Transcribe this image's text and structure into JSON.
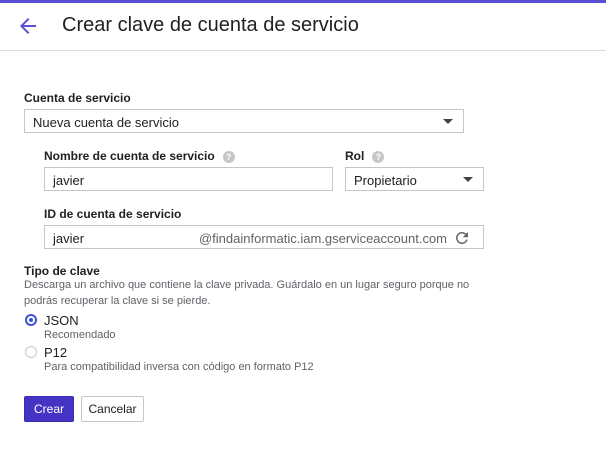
{
  "header": {
    "title": "Crear clave de cuenta de servicio"
  },
  "service_account": {
    "label": "Cuenta de servicio",
    "selected": "Nueva cuenta de servicio"
  },
  "account_name": {
    "label": "Nombre de cuenta de servicio",
    "value": "javier"
  },
  "role": {
    "label": "Rol",
    "selected": "Propietario"
  },
  "account_id": {
    "label": "ID de cuenta de servicio",
    "value": "javier",
    "suffix": "@findainformatic.iam.gserviceaccount.com"
  },
  "key_type": {
    "label": "Tipo de clave",
    "description_line1": "Descarga un archivo que contiene la clave privada. Guárdalo en un lugar seguro porque no",
    "description_line2": "podrás recuperar la clave si se pierde.",
    "options": [
      {
        "label": "JSON",
        "sub": "Recomendado",
        "selected": true
      },
      {
        "label": "P12",
        "sub": "Para compatibilidad inversa con código en formato P12",
        "selected": false
      }
    ]
  },
  "actions": {
    "create": "Crear",
    "cancel": "Cancelar"
  },
  "colors": {
    "accent": "#4534c4",
    "top_bar": "#5b4fd6"
  }
}
